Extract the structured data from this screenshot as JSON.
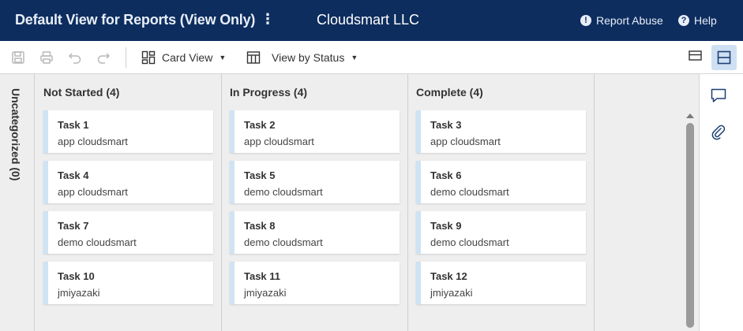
{
  "header": {
    "title": "Default View for Reports (View Only)",
    "kebab": "⋮",
    "company": "Cloudsmart LLC",
    "report_abuse": "Report Abuse",
    "help": "Help"
  },
  "toolbar": {
    "card_view": "Card View",
    "view_by_status": "View by Status",
    "caret": "▼"
  },
  "board": {
    "uncategorized": "Uncategorized (0)",
    "columns": [
      {
        "title": "Not Started (4)",
        "cards": [
          {
            "title": "Task 1",
            "sub": "app cloudsmart"
          },
          {
            "title": "Task 4",
            "sub": "app cloudsmart"
          },
          {
            "title": "Task 7",
            "sub": "demo cloudsmart"
          },
          {
            "title": "Task 10",
            "sub": "jmiyazaki"
          }
        ]
      },
      {
        "title": "In Progress (4)",
        "cards": [
          {
            "title": "Task 2",
            "sub": "app cloudsmart"
          },
          {
            "title": "Task 5",
            "sub": "demo cloudsmart"
          },
          {
            "title": "Task 8",
            "sub": "demo cloudsmart"
          },
          {
            "title": "Task 11",
            "sub": "jmiyazaki"
          }
        ]
      },
      {
        "title": "Complete (4)",
        "cards": [
          {
            "title": "Task 3",
            "sub": "app cloudsmart"
          },
          {
            "title": "Task 6",
            "sub": "demo cloudsmart"
          },
          {
            "title": "Task 9",
            "sub": "demo cloudsmart"
          },
          {
            "title": "Task 12",
            "sub": "jmiyazaki"
          }
        ]
      }
    ]
  },
  "colors": {
    "header_bg": "#0d2d5e",
    "board_bg": "#eeeeee",
    "card_accent": "#cfe3f4",
    "active_toggle": "#cfe0f3"
  },
  "icons": [
    "save-icon",
    "print-icon",
    "undo-icon",
    "redo-icon",
    "card-view-icon",
    "grid-view-icon",
    "collapse-panel-icon",
    "split-view-icon",
    "comment-icon",
    "attachment-icon",
    "info-icon",
    "help-icon"
  ]
}
